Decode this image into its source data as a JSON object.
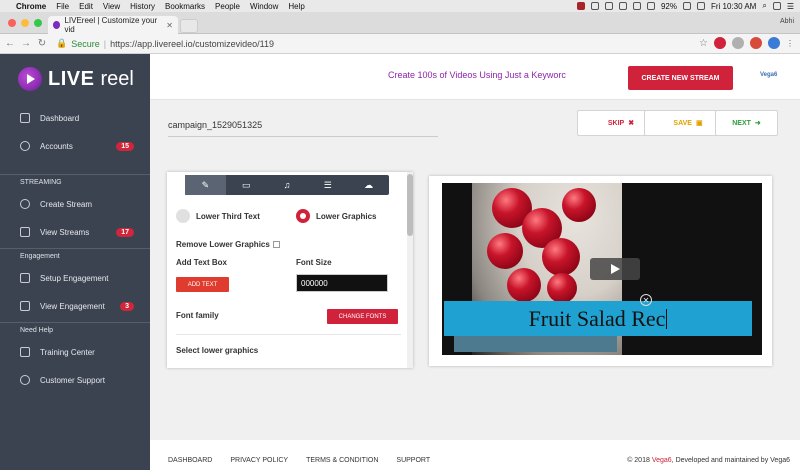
{
  "mac_menu": {
    "app": "Chrome",
    "items": [
      "File",
      "Edit",
      "View",
      "History",
      "Bookmarks",
      "People",
      "Window",
      "Help"
    ],
    "battery": "92%",
    "clock": "Fri 10:30 AM"
  },
  "browser": {
    "tab_title": "LIVEreel | Customize your vid",
    "profile": "Abhi",
    "secure_label": "Secure",
    "url": "https://app.livereel.io/customizevideo/119"
  },
  "brand": {
    "live": "LIVE",
    "reel": "reel"
  },
  "sidebar": {
    "items_top": [
      {
        "label": "Dashboard",
        "icon": "dashboard-icon"
      },
      {
        "label": "Accounts",
        "icon": "user-icon",
        "badge": "15"
      }
    ],
    "streaming_title": "STREAMING",
    "streaming": [
      {
        "label": "Create Stream",
        "icon": "cloud-upload-icon"
      },
      {
        "label": "View Streams",
        "icon": "list-icon",
        "badge": "17"
      }
    ],
    "engagement_title": "Engagement",
    "engagement": [
      {
        "label": "Setup Engagement",
        "icon": "chat-icon"
      },
      {
        "label": "View Engagement",
        "icon": "list-icon",
        "badge": "3"
      }
    ],
    "help_title": "Need Help",
    "help": [
      {
        "label": "Training Center",
        "icon": "book-icon"
      },
      {
        "label": "Customer Support",
        "icon": "question-icon"
      }
    ]
  },
  "header": {
    "tagline": "Create 100s of Videos Using Just a Keyworc",
    "create_button": "CREATE NEW STREAM",
    "partner_logo": "Vega6"
  },
  "main": {
    "campaign": "campaign_1529051325",
    "skip": "SKIP",
    "save": "SAVE",
    "next": "NEXT"
  },
  "editor": {
    "tool_icons": [
      "edit-icon",
      "window-icon",
      "music-icon",
      "menu-icon",
      "cloud-upload-icon"
    ],
    "lower_third": "Lower Third Text",
    "lower_graphics": "Lower Graphics",
    "remove_lower_graphics": "Remove Lower Graphics",
    "add_text_box": "Add Text Box",
    "add_text_button": "ADD TEXT",
    "font_size": "Font Size",
    "font_size_value": "000000",
    "font_family": "Font family",
    "change_fonts": "CHANGE FONTS",
    "select_lower_graphics": "Select lower graphics"
  },
  "preview": {
    "overlay_text": "Fruit Salad Rec"
  },
  "footer": {
    "links": [
      "DASHBOARD",
      "PRIVACY POLICY",
      "TERMS & CONDITION",
      "SUPPORT"
    ],
    "copyright_prefix": "© 2018",
    "copyright_link": "Vega6",
    "copyright_suffix": ", Developed and maintained by Vega6"
  },
  "colors": {
    "accent": "#d0223a",
    "sidebar": "#3b4350",
    "overlay": "#1fa2d2",
    "tagline": "#8e24aa"
  }
}
